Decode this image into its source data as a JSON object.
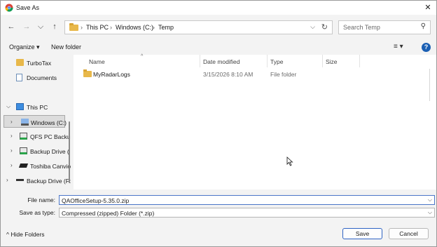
{
  "window": {
    "title": "Save As",
    "close_glyph": "✕"
  },
  "nav_row": {
    "back": "←",
    "forward": "→",
    "recent": "⌵",
    "up": "↑",
    "breadcrumb": [
      "This PC",
      "Windows (C:)",
      "Temp"
    ],
    "separator": "›",
    "dropdown": "⌵",
    "refresh": "↻",
    "search_placeholder": "Search Temp",
    "search_icon": "⚲"
  },
  "toolbar": {
    "organize": "Organize ▾",
    "new_folder": "New folder",
    "view_icon": "≡ ▾",
    "help": "?"
  },
  "sidebar": {
    "items": [
      {
        "label": "TurboTax",
        "icon": "folder-icon",
        "chevron": ""
      },
      {
        "label": "Documents",
        "icon": "documents-icon",
        "chevron": ""
      },
      {
        "label": "This PC",
        "icon": "pc-icon",
        "chevron": "⌵"
      },
      {
        "label": "Windows (C:)",
        "icon": "drive-icon",
        "chevron": "›"
      },
      {
        "label": "QFS PC Backup",
        "icon": "network-drive-icon",
        "chevron": "›"
      },
      {
        "label": "Backup Drive (",
        "icon": "network-drive-icon",
        "chevron": "›"
      },
      {
        "label": "Toshiba Canvio",
        "icon": "usb-drive-icon",
        "chevron": "›"
      },
      {
        "label": "Backup Drive (F:",
        "icon": "external-drive-icon",
        "chevron": "›"
      }
    ]
  },
  "columns": {
    "name": "Name",
    "date": "Date modified",
    "type": "Type",
    "size": "Size",
    "sort_caret": "^"
  },
  "files": [
    {
      "name": "MyRadarLogs",
      "date": "3/15/2026 8:10 AM",
      "type": "File folder",
      "size": ""
    }
  ],
  "form": {
    "file_name_label": "File name:",
    "file_name_value": "QAOfficeSetup-5.35.0.zip",
    "save_type_label": "Save as type:",
    "save_type_value": "Compressed (zipped) Folder (*.zip)",
    "dropdown": "⌵"
  },
  "footer": {
    "hide_folders": "^ Hide Folders",
    "save": "Save",
    "cancel": "Cancel"
  },
  "colors": {
    "accent": "#2f63c3",
    "folder": "#e8b84a",
    "help": "#1b5fb3"
  }
}
